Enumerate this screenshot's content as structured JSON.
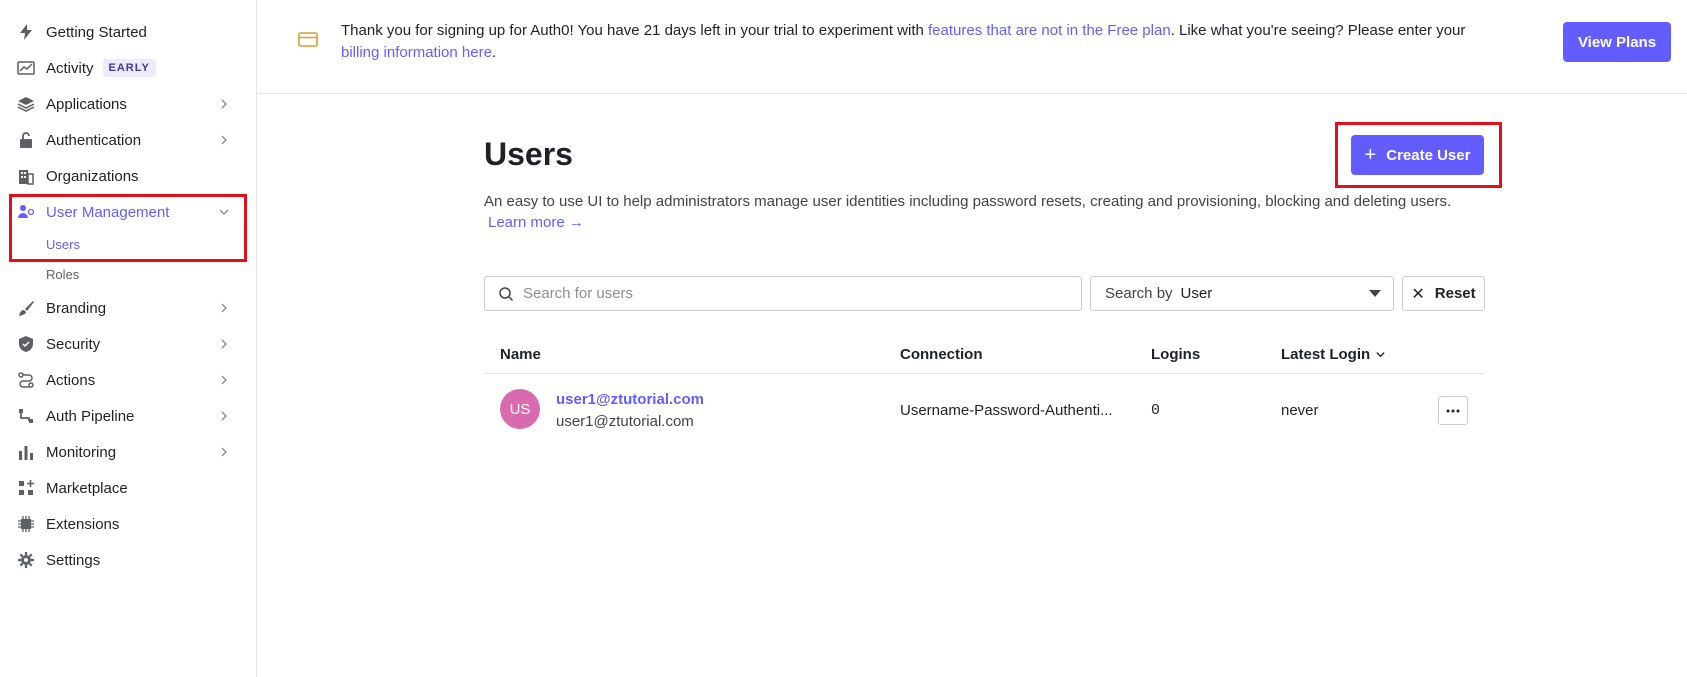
{
  "sidebar": {
    "items": [
      {
        "label": "Getting Started"
      },
      {
        "label": "Activity",
        "badge": "EARLY"
      },
      {
        "label": "Applications"
      },
      {
        "label": "Authentication"
      },
      {
        "label": "Organizations"
      },
      {
        "label": "User Management"
      },
      {
        "label": "Branding"
      },
      {
        "label": "Security"
      },
      {
        "label": "Actions"
      },
      {
        "label": "Auth Pipeline"
      },
      {
        "label": "Monitoring"
      },
      {
        "label": "Marketplace"
      },
      {
        "label": "Extensions"
      },
      {
        "label": "Settings"
      }
    ],
    "sub_items": [
      {
        "label": "Users"
      },
      {
        "label": "Roles"
      }
    ]
  },
  "banner": {
    "text_before": "Thank you for signing up for Auth0! You have 21 days left in your trial to experiment with ",
    "link1": "features that are not in the Free plan",
    "text_middle": ". Like what you're seeing? Please enter your ",
    "link2": "billing information here",
    "text_after": ".",
    "button": "View Plans"
  },
  "main": {
    "title": "Users",
    "create_button": "Create User",
    "description": "An easy to use UI to help administrators manage user identities including password resets, creating and provisioning, blocking and deleting users.",
    "learn_more": "Learn more →",
    "search_placeholder": "Search for users",
    "search_by_label": "Search by",
    "search_by_value": "User",
    "reset_button": "Reset",
    "table": {
      "headers": [
        "Name",
        "Connection",
        "Logins",
        "Latest Login"
      ],
      "rows": [
        {
          "initials": "US",
          "name": "user1@ztutorial.com",
          "email": "user1@ztutorial.com",
          "connection": "Username-Password-Authenti...",
          "logins": "0",
          "latest_login": "never"
        }
      ]
    }
  },
  "colors": {
    "accent": "#635dff",
    "highlight": "#e0111b",
    "avatar": "#d96aaf"
  }
}
